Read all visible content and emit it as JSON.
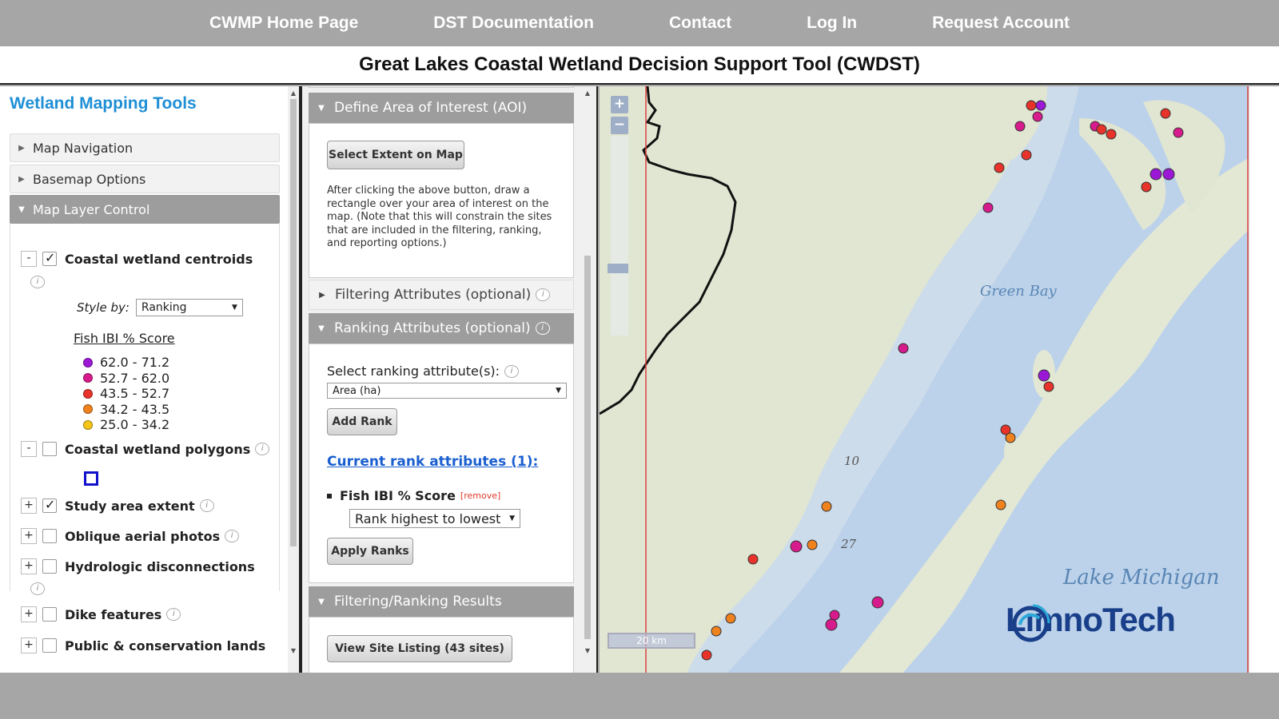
{
  "topnav": {
    "links": [
      "CWMP Home Page",
      "DST Documentation",
      "Contact",
      "Log In",
      "Request Account"
    ]
  },
  "title": "Great Lakes Coastal Wetland Decision Support Tool (CWDST)",
  "left_panel": {
    "title": "Wetland Mapping Tools",
    "accordion": {
      "map_navigation": "Map Navigation",
      "basemap_options": "Basemap Options",
      "map_layer_control": "Map Layer Control"
    },
    "layers": {
      "centroids": {
        "label": "Coastal wetland centroids",
        "checked": true,
        "toggle": "-"
      },
      "polygons": {
        "label": "Coastal wetland polygons",
        "checked": false,
        "toggle": "-"
      },
      "study_area": {
        "label": "Study area extent",
        "checked": true,
        "toggle": "+"
      },
      "oblique": {
        "label": "Oblique aerial photos",
        "checked": false,
        "toggle": "+"
      },
      "hydrologic": {
        "label": "Hydrologic disconnections",
        "checked": false,
        "toggle": "+"
      },
      "dike": {
        "label": "Dike features",
        "checked": false,
        "toggle": "+"
      },
      "public": {
        "label": "Public & conservation lands",
        "checked": false,
        "toggle": "+"
      }
    },
    "style_by": {
      "label": "Style by:",
      "value": "Ranking"
    },
    "legend": {
      "title": "Fish IBI % Score",
      "items": [
        {
          "range": "62.0 - 71.2",
          "color": "#9b18d6"
        },
        {
          "range": "52.7 - 62.0",
          "color": "#d81b8c"
        },
        {
          "range": "43.5 - 52.7",
          "color": "#e8332a"
        },
        {
          "range": "34.2 - 43.5",
          "color": "#f0821e"
        },
        {
          "range": "25.0 - 34.2",
          "color": "#f5c518"
        }
      ]
    }
  },
  "mid_panel": {
    "aoi": {
      "header": "Define Area of Interest (AOI)",
      "button": "Select Extent on Map",
      "help_lines": [
        "After clicking the above button, draw a",
        "rectangle over your area of interest on the",
        "map. (Note that this will constrain the sites",
        "that are included in the filtering, ranking,",
        "and reporting options.)"
      ]
    },
    "filtering": {
      "header": "Filtering Attributes (optional)"
    },
    "ranking": {
      "header": "Ranking Attributes (optional)",
      "select_label": "Select ranking attribute(s):",
      "select_value": "Area (ha)",
      "add_button": "Add Rank",
      "current_link": "Current rank attributes (1):",
      "item_label": "Fish IBI % Score",
      "remove_label": "[remove]",
      "order_value": "Rank highest to lowest",
      "apply_button": "Apply Ranks"
    },
    "results": {
      "header": "Filtering/Ranking Results",
      "button": "View Site Listing (43 sites)"
    }
  },
  "map": {
    "zoom_in": "+",
    "zoom_out": "−",
    "scale_label": "20 km",
    "labels": {
      "green_bay": "Green Bay",
      "lake_michigan": "Lake Michigan",
      "road_10": "10",
      "road_27": "27"
    },
    "logo_text": "LimnoTech",
    "colors": {
      "water": "#b9d0ea",
      "land": "#dfe4cf",
      "purple": "#9b18d6",
      "magenta": "#d81b8c",
      "red": "#e8332a",
      "orange": "#f0821e"
    }
  }
}
